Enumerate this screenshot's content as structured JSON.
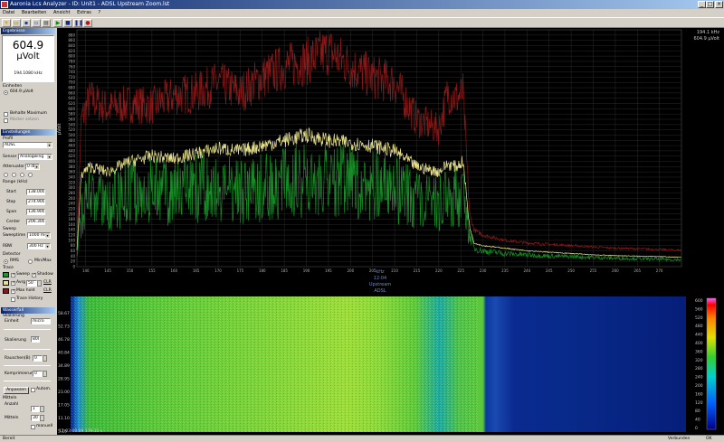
{
  "window": {
    "title": "Aaronia Lcs Analyzer - ID: Unit1 - ADSL Upstream Zoom.lst",
    "minimize": "_",
    "maximize": "□",
    "close": "×"
  },
  "menu": [
    "Datei",
    "Bearbeiten",
    "Ansicht",
    "Extras",
    "?"
  ],
  "toolbar_icons": [
    "new-icon",
    "open-icon",
    "save-icon",
    "save-as-icon",
    "print-icon",
    "play-icon",
    "stop-icon",
    "pause-icon",
    "record-icon"
  ],
  "measurement": {
    "header": "Ergebnisse",
    "panel_title": "Ergebnisse",
    "value": "604.9",
    "unit": "µVolt",
    "freq": "194.1080 kHz",
    "section_label": "Einheiten",
    "unit_option": "604.9 µVolt",
    "max_hold_label": "Behalte Maximum",
    "marker_label": "Marker setzen"
  },
  "settings": {
    "header": "Einstellungen",
    "profile_label": "Profil",
    "profile_value": "ADSL",
    "sensor_label": "Sensor",
    "sensor_value": "Analogwing",
    "attenuator_label": "Attenuator",
    "attenuator_value": "0 dB",
    "range_label": "Range (kHz)",
    "start_label": "Start",
    "start_value": "138.000",
    "stop_label": "Stop",
    "stop_value": "274.900",
    "span_label": "Span",
    "span_value": "136.900",
    "center_label": "Center",
    "center_value": "206.300",
    "sweep_label": "Sweep",
    "sweeptime_label": "Sweeptime",
    "sweeptime_value": "1000 ms",
    "rbw_label": "RBW",
    "rbw_value": "300 Hz",
    "detector_label": "Detector",
    "rms_label": "RMS",
    "minmax_label": "Min/Max",
    "trace_label": "Trace",
    "sweep_trace": "Sweep",
    "shadow_label": "Shadow",
    "avg_label": "Avrg",
    "avg_value": "50",
    "clr": "CLR",
    "maxhold_trace": "Max hold",
    "trace_history": "Trace History",
    "colors": {
      "sweep": "#1a9a2a",
      "avg": "#e8e28a",
      "max": "#8a1a1a"
    }
  },
  "waterfall_settings": {
    "header": "Wasserfall",
    "scaling_label": "Skalierung",
    "unit_label": "Einheit",
    "unit_value": "micro",
    "scale_label": "Skalierung",
    "scale_value": "800",
    "noise_label": "Rauschen(B)",
    "noise_value": "0",
    "compress_label": "Komprimierung",
    "compress_value": "0",
    "adjust_btn": "Anpassen",
    "auto_label": "Autom.",
    "averaging_label": "Mitteln",
    "count_label": "Anzahl",
    "count_value": "1",
    "averaging_value_label": "Mitteln",
    "averaging_value": "30",
    "manual_label": "manuell"
  },
  "chart": {
    "ylabel": "µVolt",
    "xlabel": "kHz",
    "timestamp": "12:04",
    "series_label": "Upstream",
    "profile_label": "ADSL",
    "topright_freq": "194.1 kHz",
    "topright_val": "604.9 µVolt"
  },
  "chart_data": {
    "type": "line",
    "xlabel": "kHz",
    "ylabel": "µVolt",
    "xlim": [
      138,
      275
    ],
    "ylim": [
      0,
      900
    ],
    "y_ticks": [
      0,
      20,
      40,
      60,
      80,
      100,
      120,
      140,
      160,
      180,
      200,
      220,
      240,
      260,
      280,
      300,
      320,
      340,
      360,
      380,
      400,
      420,
      440,
      460,
      480,
      500,
      520,
      540,
      560,
      580,
      600,
      620,
      640,
      660,
      680,
      700,
      720,
      740,
      760,
      780,
      800,
      820,
      840,
      860,
      880
    ],
    "x_ticks": [
      140,
      145,
      150,
      155,
      160,
      165,
      170,
      175,
      180,
      185,
      190,
      195,
      200,
      205,
      210,
      215,
      220,
      225,
      230,
      235,
      240,
      245,
      250,
      255,
      260,
      265,
      270
    ],
    "grid": true,
    "series": [
      {
        "x": [
          138,
          139,
          141,
          145,
          150,
          155,
          160,
          165,
          170,
          175,
          180,
          185,
          190,
          195,
          200,
          205,
          210,
          215,
          220,
          222,
          224,
          225.5,
          227,
          228,
          230,
          235,
          240,
          245,
          250,
          255,
          260,
          265,
          270,
          275
        ],
        "y": [
          90,
          560,
          640,
          600,
          620,
          610,
          650,
          660,
          700,
          660,
          720,
          760,
          780,
          820,
          760,
          720,
          700,
          560,
          520,
          660,
          640,
          660,
          200,
          140,
          120,
          100,
          90,
          85,
          80,
          75,
          70,
          68,
          65,
          62
        ]
      },
      {
        "x": [
          138,
          139,
          141,
          145,
          150,
          155,
          160,
          165,
          170,
          175,
          180,
          185,
          190,
          195,
          200,
          205,
          210,
          215,
          220,
          222,
          224,
          225.5,
          227,
          228,
          230,
          235,
          240,
          245,
          250,
          255,
          260,
          265,
          270,
          275
        ],
        "y": [
          40,
          200,
          260,
          240,
          280,
          290,
          280,
          300,
          310,
          290,
          300,
          320,
          340,
          320,
          330,
          310,
          300,
          250,
          240,
          270,
          260,
          270,
          120,
          70,
          60,
          50,
          45,
          40,
          38,
          35,
          32,
          30,
          28,
          26
        ]
      },
      {
        "x": [
          138,
          139,
          141,
          145,
          150,
          155,
          160,
          165,
          170,
          175,
          180,
          185,
          190,
          195,
          200,
          205,
          210,
          215,
          220,
          222,
          224,
          225.5,
          227,
          228,
          230,
          235,
          240,
          245,
          250,
          255,
          260,
          265,
          270,
          275
        ],
        "y": [
          60,
          350,
          380,
          360,
          400,
          420,
          410,
          430,
          450,
          440,
          460,
          480,
          500,
          480,
          470,
          460,
          440,
          380,
          360,
          390,
          380,
          400,
          150,
          90,
          80,
          70,
          60,
          55,
          50,
          45,
          42,
          40,
          38,
          35
        ]
      }
    ]
  },
  "waterfall": {
    "y_labels": [
      "58.67",
      "52.73",
      "46.78",
      "40.84",
      "34.89",
      "28.95",
      "23.00",
      "17.05",
      "11.10",
      "5.16"
    ],
    "bottom_label": "12:03:00.09 179.11 s",
    "scale_labels": [
      "600",
      "560",
      "520",
      "480",
      "440",
      "400",
      "360",
      "320",
      "280",
      "240",
      "200",
      "160",
      "120",
      "80",
      "40",
      "0"
    ]
  },
  "status": {
    "left": "Bereit",
    "mid": "Verbunden",
    "right": "OK"
  }
}
